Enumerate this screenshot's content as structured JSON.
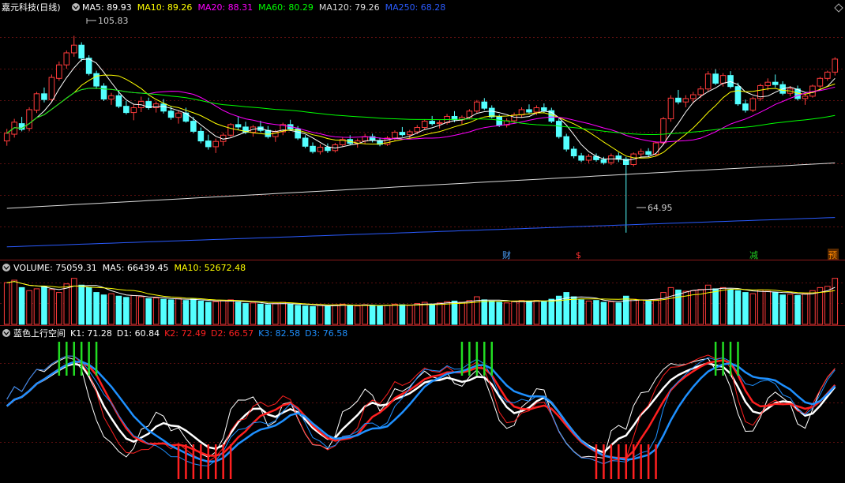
{
  "stock": {
    "name": "嘉元科技(日线)",
    "ma": [
      {
        "label": "MA5: 89.93",
        "color": "#ffffff"
      },
      {
        "label": "MA10: 89.26",
        "color": "#ffff00"
      },
      {
        "label": "MA20: 88.31",
        "color": "#ff00ff"
      },
      {
        "label": "MA60: 80.29",
        "color": "#00ff00"
      },
      {
        "label": "MA120: 79.26",
        "color": "#dddddd"
      },
      {
        "label": "MA250: 68.28",
        "color": "#2a5bff"
      }
    ],
    "high_label": "105.83",
    "low_label": "64.95",
    "events": [
      {
        "label": "财",
        "color": "#4fa3ff"
      },
      {
        "label": "$",
        "color": "#ff3030"
      },
      {
        "label": "减",
        "color": "#22cc22"
      },
      {
        "label": "预",
        "color": "#ff8800"
      }
    ]
  },
  "volume": {
    "labels": [
      {
        "label": "VOLUME: 75059.31",
        "color": "#ffffff"
      },
      {
        "label": "MA5: 66439.45",
        "color": "#ffffff"
      },
      {
        "label": "MA10: 52672.48",
        "color": "#ffff00"
      }
    ]
  },
  "indicator": {
    "name": "蓝色上行空间",
    "labels": [
      {
        "label": "K1: 71.28",
        "color": "#ffffff"
      },
      {
        "label": "D1: 60.84",
        "color": "#ffffff"
      },
      {
        "label": "K2: 72.49",
        "color": "#ff2020"
      },
      {
        "label": "D2: 66.57",
        "color": "#ff2020"
      },
      {
        "label": "K3: 82.58",
        "color": "#1e90ff"
      },
      {
        "label": "D3: 76.58",
        "color": "#1e90ff"
      }
    ]
  },
  "chart_data": {
    "type": "candlestick",
    "dates": [],
    "ohlc": [
      [
        84.0,
        86.5,
        83.0,
        85.6
      ],
      [
        85.4,
        88.6,
        84.7,
        87.9
      ],
      [
        87.6,
        89.0,
        86.0,
        86.4
      ],
      [
        86.6,
        91.0,
        86.0,
        90.5
      ],
      [
        90.4,
        94.2,
        89.8,
        93.8
      ],
      [
        93.8,
        95.1,
        92.0,
        92.6
      ],
      [
        92.6,
        97.8,
        92.0,
        97.2
      ],
      [
        97.0,
        100.5,
        96.5,
        99.8
      ],
      [
        99.8,
        102.8,
        99.0,
        102.3
      ],
      [
        102.3,
        105.83,
        101.5,
        103.9
      ],
      [
        103.9,
        104.5,
        100.5,
        101.2
      ],
      [
        101.2,
        101.8,
        97.6,
        98.0
      ],
      [
        98.0,
        98.6,
        94.8,
        95.4
      ],
      [
        95.4,
        96.0,
        92.3,
        92.7
      ],
      [
        92.7,
        94.0,
        91.5,
        93.4
      ],
      [
        93.4,
        94.4,
        90.8,
        91.2
      ],
      [
        91.2,
        92.3,
        89.5,
        89.9
      ],
      [
        89.9,
        91.6,
        88.3,
        90.9
      ],
      [
        90.9,
        93.2,
        90.0,
        92.2
      ],
      [
        92.2,
        93.0,
        90.5,
        90.9
      ],
      [
        90.9,
        92.2,
        89.9,
        91.7
      ],
      [
        91.7,
        92.7,
        89.7,
        90.2
      ],
      [
        90.2,
        91.3,
        88.4,
        88.9
      ],
      [
        88.9,
        90.3,
        87.6,
        89.8
      ],
      [
        89.8,
        90.9,
        87.8,
        88.1
      ],
      [
        88.1,
        89.0,
        85.6,
        86.0
      ],
      [
        86.0,
        86.8,
        83.5,
        84.0
      ],
      [
        84.0,
        85.3,
        82.2,
        82.8
      ],
      [
        82.8,
        84.5,
        81.5,
        83.9
      ],
      [
        83.9,
        85.7,
        83.0,
        85.2
      ],
      [
        85.2,
        87.7,
        84.8,
        87.4
      ],
      [
        87.4,
        89.0,
        86.3,
        86.9
      ],
      [
        86.9,
        88.0,
        85.4,
        85.8
      ],
      [
        85.8,
        87.3,
        84.9,
        86.9
      ],
      [
        86.9,
        88.2,
        85.8,
        86.2
      ],
      [
        86.2,
        87.1,
        84.5,
        84.9
      ],
      [
        84.9,
        86.3,
        83.8,
        85.9
      ],
      [
        85.9,
        87.8,
        85.2,
        87.4
      ],
      [
        87.4,
        88.4,
        86.1,
        86.5
      ],
      [
        86.5,
        87.1,
        84.2,
        84.6
      ],
      [
        84.6,
        85.2,
        82.5,
        82.9
      ],
      [
        82.9,
        83.7,
        81.4,
        81.8
      ],
      [
        81.8,
        83.3,
        81.2,
        82.7
      ],
      [
        82.7,
        83.5,
        81.5,
        82.0
      ],
      [
        82.0,
        83.6,
        81.6,
        83.2
      ],
      [
        83.2,
        84.8,
        82.8,
        84.3
      ],
      [
        84.3,
        85.2,
        83.1,
        83.5
      ],
      [
        83.5,
        84.5,
        82.6,
        84.0
      ],
      [
        84.0,
        85.5,
        83.4,
        84.9
      ],
      [
        84.9,
        85.5,
        83.7,
        84.1
      ],
      [
        84.1,
        84.7,
        82.9,
        83.3
      ],
      [
        83.3,
        85.0,
        83.0,
        84.6
      ],
      [
        84.6,
        86.2,
        84.1,
        85.8
      ],
      [
        85.8,
        86.9,
        84.9,
        85.3
      ],
      [
        85.3,
        86.3,
        84.4,
        85.9
      ],
      [
        85.9,
        87.3,
        85.4,
        86.8
      ],
      [
        86.8,
        88.5,
        86.3,
        88.1
      ],
      [
        88.1,
        89.2,
        87.2,
        87.6
      ],
      [
        87.6,
        88.3,
        86.6,
        87.8
      ],
      [
        87.8,
        89.6,
        87.4,
        89.1
      ],
      [
        89.1,
        90.2,
        87.9,
        88.4
      ],
      [
        88.4,
        89.3,
        87.5,
        88.9
      ],
      [
        88.9,
        90.6,
        88.5,
        90.2
      ],
      [
        90.2,
        92.5,
        89.8,
        92.1
      ],
      [
        92.1,
        92.9,
        90.4,
        90.8
      ],
      [
        90.8,
        91.4,
        88.7,
        89.0
      ],
      [
        89.0,
        89.5,
        86.9,
        87.3
      ],
      [
        87.3,
        88.7,
        86.8,
        88.2
      ],
      [
        88.2,
        89.9,
        87.7,
        89.4
      ],
      [
        89.4,
        91.0,
        88.8,
        90.5
      ],
      [
        90.5,
        91.6,
        89.6,
        90.0
      ],
      [
        90.0,
        91.4,
        89.4,
        90.9
      ],
      [
        90.9,
        91.8,
        89.8,
        90.3
      ],
      [
        90.3,
        90.9,
        87.7,
        88.1
      ],
      [
        88.1,
        88.7,
        84.5,
        84.9
      ],
      [
        84.9,
        85.5,
        81.8,
        82.3
      ],
      [
        82.3,
        82.9,
        80.4,
        80.9
      ],
      [
        80.9,
        81.5,
        79.6,
        80.0
      ],
      [
        80.0,
        81.3,
        79.4,
        80.8
      ],
      [
        80.8,
        81.4,
        79.7,
        80.1
      ],
      [
        80.1,
        80.7,
        79.1,
        79.5
      ],
      [
        79.5,
        81.4,
        79.0,
        80.9
      ],
      [
        80.9,
        81.6,
        79.6,
        80.2
      ],
      [
        80.2,
        80.7,
        64.95,
        79.1
      ],
      [
        79.1,
        81.6,
        78.7,
        81.3
      ],
      [
        81.3,
        82.4,
        80.5,
        81.8
      ],
      [
        81.8,
        82.5,
        80.8,
        81.2
      ],
      [
        81.2,
        83.9,
        80.9,
        83.6
      ],
      [
        83.6,
        89.0,
        83.1,
        88.6
      ],
      [
        88.6,
        93.5,
        88.0,
        92.9
      ],
      [
        92.9,
        94.6,
        91.6,
        92.1
      ],
      [
        92.1,
        93.5,
        91.0,
        92.8
      ],
      [
        92.8,
        94.2,
        91.8,
        93.6
      ],
      [
        93.6,
        95.4,
        92.9,
        94.8
      ],
      [
        94.8,
        98.5,
        94.2,
        97.9
      ],
      [
        97.9,
        98.9,
        95.6,
        96.0
      ],
      [
        96.0,
        98.1,
        95.3,
        97.6
      ],
      [
        97.6,
        98.5,
        94.9,
        95.3
      ],
      [
        95.3,
        96.1,
        91.3,
        91.7
      ],
      [
        91.7,
        92.6,
        89.9,
        90.4
      ],
      [
        90.4,
        93.2,
        90.0,
        92.8
      ],
      [
        92.8,
        95.9,
        92.3,
        95.5
      ],
      [
        95.5,
        97.0,
        94.5,
        96.2
      ],
      [
        96.2,
        97.8,
        95.1,
        95.7
      ],
      [
        95.7,
        96.4,
        93.5,
        93.9
      ],
      [
        93.9,
        95.4,
        93.3,
        94.8
      ],
      [
        94.8,
        95.5,
        92.4,
        92.8
      ],
      [
        92.8,
        93.8,
        91.5,
        93.3
      ],
      [
        93.3,
        95.7,
        93.0,
        95.4
      ],
      [
        95.4,
        97.3,
        94.9,
        97.0
      ],
      [
        97.0,
        98.6,
        96.5,
        98.3
      ],
      [
        98.3,
        101.4,
        97.6,
        101.0
      ]
    ],
    "volume": [
      68000,
      72000,
      60000,
      55000,
      58000,
      62000,
      57000,
      52000,
      66000,
      75000,
      64000,
      60000,
      52000,
      48000,
      50000,
      46000,
      44000,
      47000,
      45000,
      42000,
      43000,
      41000,
      40000,
      42000,
      39000,
      41000,
      38000,
      36000,
      37000,
      39000,
      40000,
      36000,
      34000,
      35000,
      33000,
      32000,
      34000,
      36000,
      33000,
      31000,
      30000,
      29000,
      31000,
      30000,
      32000,
      33000,
      31000,
      30000,
      32000,
      31000,
      30000,
      31000,
      33000,
      32000,
      31000,
      34000,
      36000,
      33000,
      35000,
      37000,
      38000,
      36000,
      39000,
      45000,
      40000,
      38000,
      36000,
      35000,
      37000,
      39000,
      38000,
      39000,
      37000,
      41000,
      46000,
      52000,
      45000,
      40000,
      38000,
      39000,
      36000,
      37000,
      35000,
      46000,
      41000,
      40000,
      38000,
      40000,
      52000,
      60000,
      56000,
      54000,
      55000,
      57000,
      64000,
      58000,
      60000,
      56000,
      55000,
      52000,
      50000,
      56000,
      54000,
      52000,
      48000,
      49000,
      47000,
      50000,
      55000,
      60000,
      62000,
      75059.31
    ],
    "ylim_price": [
      60,
      110
    ]
  }
}
